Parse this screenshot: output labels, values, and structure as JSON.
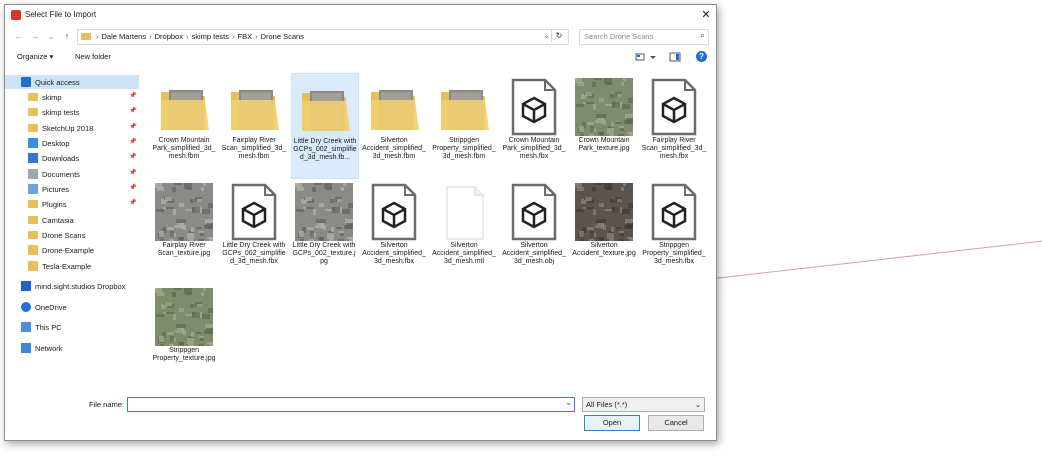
{
  "window": {
    "title": "Select File to Import",
    "close_label": "✕"
  },
  "nav": {
    "back": "←",
    "forward": "→",
    "recent": "⌄",
    "up": "↑",
    "breadcrumb": [
      "Dale Martens",
      "Dropbox",
      "skimp tests",
      "FBX",
      "Drone Scans"
    ],
    "separator": "›",
    "refresh": "↻",
    "dropdown": "⌄",
    "search_placeholder": "Search Drone Scans"
  },
  "toolbar": {
    "organize": "Organize ▾",
    "new_folder": "New folder",
    "help": "?"
  },
  "sidebar": [
    {
      "label": "Quick access",
      "icon": "star-icon",
      "pinned": false,
      "selected": true
    },
    {
      "label": "skimp",
      "icon": "folder-icon",
      "pinned": true
    },
    {
      "label": "skimp tests",
      "icon": "folder-icon",
      "pinned": true
    },
    {
      "label": "SketchUp 2018",
      "icon": "folder-icon",
      "pinned": true
    },
    {
      "label": "Desktop",
      "icon": "desktop-icon",
      "pinned": true
    },
    {
      "label": "Downloads",
      "icon": "download-icon",
      "pinned": true
    },
    {
      "label": "Documents",
      "icon": "documents-icon",
      "pinned": true
    },
    {
      "label": "Pictures",
      "icon": "pictures-icon",
      "pinned": true
    },
    {
      "label": "Plugins",
      "icon": "folder-icon",
      "pinned": true
    },
    {
      "label": "Camtasia",
      "icon": "folder-icon",
      "pinned": false
    },
    {
      "label": "Drone Scans",
      "icon": "folder-icon",
      "pinned": false
    },
    {
      "label": "Drone-Example",
      "icon": "sketchup-file-icon",
      "pinned": false
    },
    {
      "label": "Tesla-Example",
      "icon": "sketchup-file-icon",
      "pinned": false
    },
    {
      "label": "mind.sight.studios Dropbox",
      "icon": "dropbox-icon",
      "pinned": false
    },
    {
      "label": "OneDrive",
      "icon": "onedrive-icon",
      "pinned": false
    },
    {
      "label": "This PC",
      "icon": "computer-icon",
      "pinned": false
    },
    {
      "label": "Network",
      "icon": "network-icon",
      "pinned": false
    }
  ],
  "pin_glyph": "📌",
  "files": [
    {
      "name": "Crown Mountain Park_simplified_3d_mesh.fbm",
      "kind": "folder"
    },
    {
      "name": "Fairplay River Scan_simplified_3d_mesh.fbm",
      "kind": "folder"
    },
    {
      "name": "Little Dry Creek with GCPs_002_simplified_3d_mesh.fb...",
      "kind": "folder",
      "selected": true
    },
    {
      "name": "Silverton Accident_simplified_3d_mesh.fbm",
      "kind": "folder"
    },
    {
      "name": "Strippgen Property_simplified_3d_mesh.fbm",
      "kind": "folder"
    },
    {
      "name": "Crown Mountain Park_simplified_3d_mesh.fbx",
      "kind": "model"
    },
    {
      "name": "Crown Mountain Park_texture.jpg",
      "kind": "image",
      "tint": "green"
    },
    {
      "name": "Fairplay River Scan_simplified_3d_mesh.fbx",
      "kind": "model"
    },
    {
      "name": "Fairplay River Scan_texture.jpg",
      "kind": "image",
      "tint": "grey"
    },
    {
      "name": "Little Dry Creek with GCPs_002_simplified_3d_mesh.fbx",
      "kind": "model"
    },
    {
      "name": "Little Dry Creek with GCPs_002_texture.jpg",
      "kind": "image",
      "tint": "grey"
    },
    {
      "name": "Silverton Accident_simplified_3d_mesh.fbx",
      "kind": "model"
    },
    {
      "name": "Silverton Accident_simplified_3d_mesh.mtl",
      "kind": "blank"
    },
    {
      "name": "Silverton Accident_simplified_3d_mesh.obj",
      "kind": "model"
    },
    {
      "name": "Silverton Accident_texture.jpg",
      "kind": "image",
      "tint": "dark"
    },
    {
      "name": "Strippgen Property_simplified_3d_mesh.fbx",
      "kind": "model"
    },
    {
      "name": "Strippgen Property_texture.jpg",
      "kind": "image",
      "tint": "green"
    }
  ],
  "footer": {
    "file_name_label": "File name:",
    "file_name_value": "",
    "filter_value": "All Files (*.*)",
    "open_label": "Open",
    "cancel_label": "Cancel"
  },
  "colors": {
    "accent": "#3c7fd1",
    "selection": "#cde3f7",
    "folder": "#e8c05b"
  }
}
